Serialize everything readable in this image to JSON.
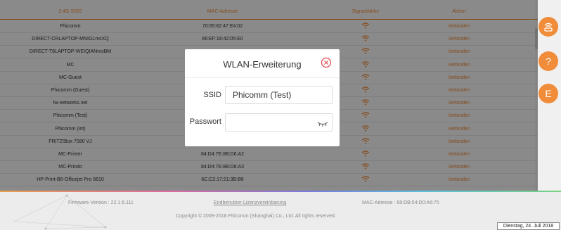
{
  "table": {
    "headers": {
      "ssid": "2.4G SSID",
      "mac": "MAC-Adresse",
      "signal": "Signalstärke",
      "action": "Aktion"
    },
    "rows": [
      {
        "ssid": "Phicomm",
        "mac": "70:65:82:47:E4:02",
        "action": "Verbinden"
      },
      {
        "ssid": "DIRECT-CRLAPTOP-MNIGLmsXQ",
        "mac": "86:EF:18:42:05:E0",
        "action": "Verbinden"
      },
      {
        "ssid": "DIRECT-T8LAPTOP-WEIQIANmsBM",
        "mac": "",
        "action": "Verbinden"
      },
      {
        "ssid": "MC",
        "mac": "",
        "action": "Verbinden"
      },
      {
        "ssid": "MC-Guest",
        "mac": "",
        "action": "Verbinden"
      },
      {
        "ssid": "Phicomm (Guest)",
        "mac": "",
        "action": "Verbinden"
      },
      {
        "ssid": "lw-networks.net",
        "mac": "",
        "action": "Verbinden"
      },
      {
        "ssid": "Phicomm (Test)",
        "mac": "",
        "action": "Verbinden"
      },
      {
        "ssid": "Phicomm (int)",
        "mac": "",
        "action": "Verbinden"
      },
      {
        "ssid": "FRITZ!Box 7580 VJ",
        "mac": "",
        "action": "Verbinden"
      },
      {
        "ssid": "MC-Printer",
        "mac": "84:D4:7E:8B:D6:A2",
        "action": "Verbinden"
      },
      {
        "ssid": "MC-Prindo",
        "mac": "84:D4:7E:8B:D6:A3",
        "action": "Verbinden"
      },
      {
        "ssid": "HP-Print-B6-Officejet Pro 8610",
        "mac": "6C:C2:17:21:3B:B6",
        "action": "Verbinden"
      }
    ]
  },
  "sidebar": {
    "buttons": [
      {
        "icon": "router-icon"
      },
      {
        "icon": "help-icon",
        "label": "?"
      },
      {
        "icon": "language-icon",
        "label": "E"
      }
    ]
  },
  "modal": {
    "title": "WLAN-Erweiterung",
    "ssid_label": "SSID",
    "ssid_value": "Phicomm (Test)",
    "password_label": "Passwort",
    "password_value": ""
  },
  "footer": {
    "firmware": "Firmware-Version : 22.1.6.111",
    "license_link": "Endbenutzer-Lizenzvereinbarung",
    "mac": "MAC-Adresse : 68:DB:54:D0:A6:75",
    "copyright": "Copyright © 2009-2018 Phicomm (Shanghai) Co., Ltd. All rights reserved."
  },
  "taskbar": {
    "date": "Dienstag, 24. Juli 2018"
  },
  "colors": {
    "accent": "#f08c3a",
    "overlay": "rgba(0,0,0,0.45)",
    "close": "#e0454a"
  }
}
